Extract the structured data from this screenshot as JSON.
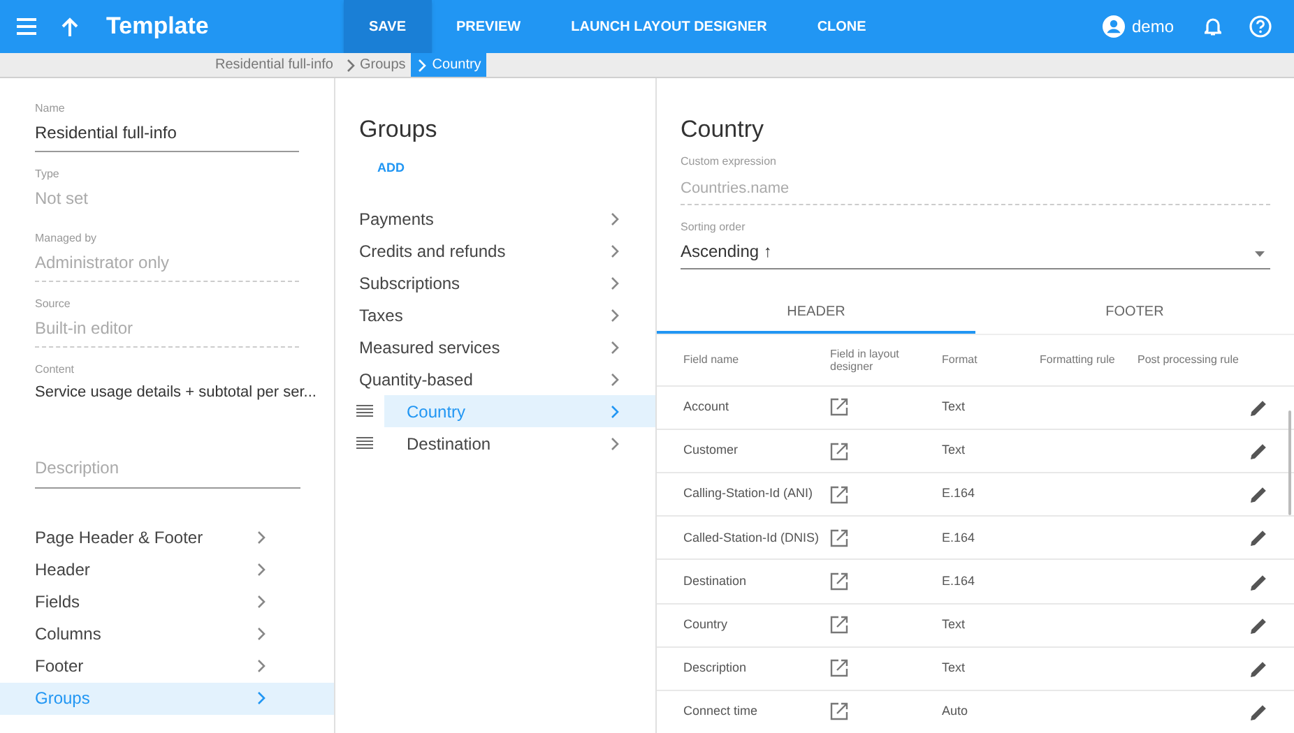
{
  "app_bar": {
    "title": "Template",
    "actions": [
      {
        "label": "SAVE",
        "selected": true
      },
      {
        "label": "PREVIEW",
        "selected": false
      },
      {
        "label": "LAUNCH LAYOUT DESIGNER",
        "selected": false
      },
      {
        "label": "CLONE",
        "selected": false
      }
    ],
    "user": "demo"
  },
  "breadcrumbs": [
    {
      "label": "Residential full-info",
      "selected": false
    },
    {
      "label": "Groups",
      "selected": false
    },
    {
      "label": "Country",
      "selected": true
    }
  ],
  "template_panel": {
    "fields": [
      {
        "label": "Name",
        "value": "Residential full-info",
        "kind": "editable"
      },
      {
        "label": "Type",
        "value": "Not set",
        "kind": "plain"
      },
      {
        "label": "Managed by",
        "value": "Administrator only",
        "kind": "readonly"
      },
      {
        "label": "Source",
        "value": "Built-in editor",
        "kind": "readonly"
      },
      {
        "label": "Content",
        "value": "Service usage details + subtotal per ser...",
        "kind": "text"
      }
    ],
    "description": {
      "placeholder": "Description"
    },
    "sections": [
      {
        "label": "Page Header & Footer",
        "selected": false
      },
      {
        "label": "Header",
        "selected": false
      },
      {
        "label": "Fields",
        "selected": false
      },
      {
        "label": "Columns",
        "selected": false
      },
      {
        "label": "Footer",
        "selected": false
      },
      {
        "label": "Groups",
        "selected": true
      }
    ]
  },
  "groups_panel": {
    "title": "Groups",
    "add": "ADD",
    "items": [
      {
        "label": "Payments",
        "kind": "fixed",
        "selected": false
      },
      {
        "label": "Credits and refunds",
        "kind": "fixed",
        "selected": false
      },
      {
        "label": "Subscriptions",
        "kind": "fixed",
        "selected": false
      },
      {
        "label": "Taxes",
        "kind": "fixed",
        "selected": false
      },
      {
        "label": "Measured services",
        "kind": "fixed",
        "selected": false
      },
      {
        "label": "Quantity-based",
        "kind": "fixed",
        "selected": false
      },
      {
        "label": "Country",
        "kind": "draggable",
        "selected": true
      },
      {
        "label": "Destination",
        "kind": "draggable",
        "selected": false
      }
    ]
  },
  "group_detail": {
    "title": "Country",
    "custom_expression": {
      "label": "Custom expression",
      "placeholder": "Countries.name"
    },
    "sorting_order": {
      "label": "Sorting order",
      "value": "Ascending ↑"
    },
    "tabs": [
      {
        "label": "HEADER",
        "selected": true
      },
      {
        "label": "FOOTER",
        "selected": false
      }
    ],
    "table": {
      "columns": [
        "Field name",
        "Field in layout designer",
        "Format",
        "Formatting rule",
        "Post processing rule"
      ],
      "rows": [
        {
          "field_name": "Account",
          "format": "Text"
        },
        {
          "field_name": "Customer",
          "format": "Text"
        },
        {
          "field_name": "Calling-Station-Id (ANI)",
          "format": "E.164"
        },
        {
          "field_name": "Called-Station-Id (DNIS)",
          "format": "E.164"
        },
        {
          "field_name": "Destination",
          "format": "E.164"
        },
        {
          "field_name": "Country",
          "format": "Text"
        },
        {
          "field_name": "Description",
          "format": "Text"
        },
        {
          "field_name": "Connect time",
          "format": "Auto"
        }
      ]
    }
  }
}
